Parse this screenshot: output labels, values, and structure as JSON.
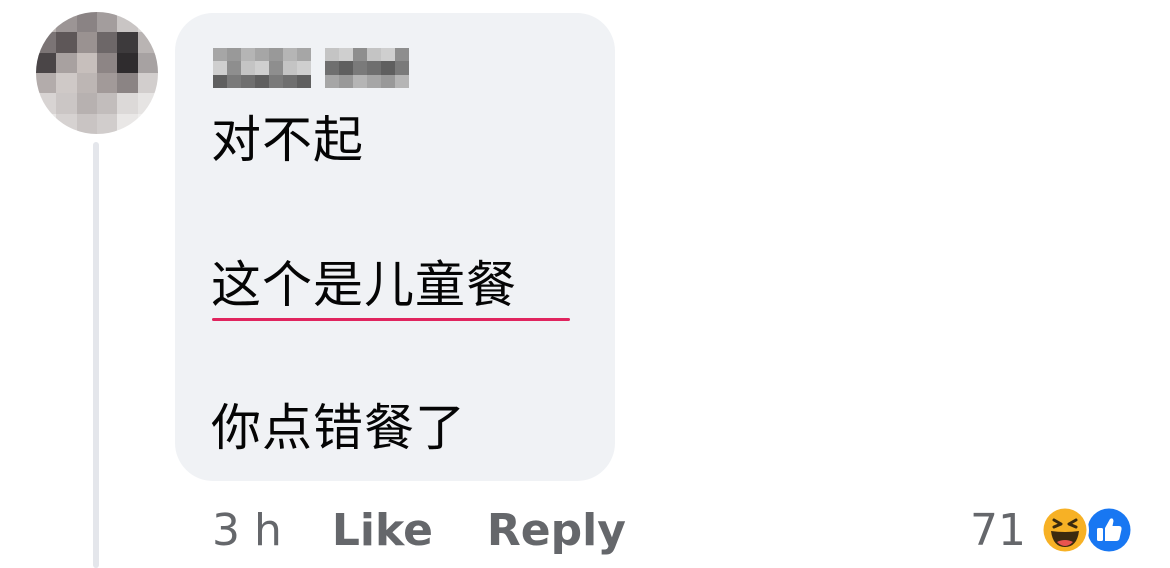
{
  "comment": {
    "lines": [
      "对不起",
      "这个是儿童餐",
      "你点错餐了"
    ]
  },
  "actions": {
    "time": "3 h",
    "like": "Like",
    "reply": "Reply"
  },
  "reactions": {
    "count": "71",
    "icons": [
      "haha-icon",
      "like-icon"
    ]
  },
  "colors": {
    "bubble": "#f0f2f5",
    "text": "#050505",
    "meta": "#65676b",
    "like_blue": "#1877f2",
    "haha_yellow": "#f7b125",
    "spellcheck_underline": "#e0245e"
  }
}
